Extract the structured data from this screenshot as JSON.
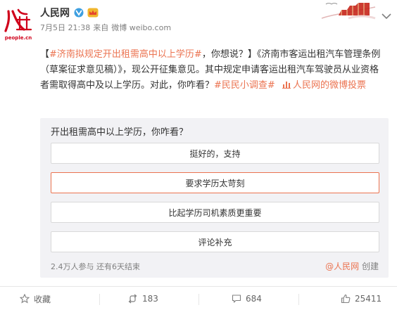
{
  "avatar": {
    "logo_text": "人民网",
    "domain_text": "people.cn",
    "icon": "people-daily-logo"
  },
  "post": {
    "author": "人民网",
    "verified_icon": "verified-v-icon",
    "member_icon": "vip-crown-icon",
    "date": "7月5日 21:38",
    "source_prefix": "来自",
    "source": "微博 weibo.com",
    "text": {
      "bracket_open": "【",
      "topic1": "#济南拟规定开出租需高中以上学历#",
      "line1_rest": "，你想说？】《济南市客运出租汽车管理条例（草案征求意见稿）》，现公开征集意见。其中规定申请客运出租汽车驾驶员从业资格者需取得高中及以上学历。对此，你咋看？",
      "topic2": "#民民小调查#",
      "vote_link": "人民网的微博投票"
    }
  },
  "poll": {
    "question": "开出租需高中以上学历，你咋看？",
    "options": [
      {
        "label": "挺好的，支持"
      },
      {
        "label": "要求学历太苛刻"
      },
      {
        "label": "比起学历司机素质更重要"
      },
      {
        "label": "评论补充"
      }
    ],
    "participants": "2.4万人参与",
    "remaining": "还有6天结束",
    "creator": "@人民网",
    "created_label": "创建"
  },
  "actions": {
    "favorite": "收藏",
    "repost": "183",
    "comment": "684",
    "like": "25411"
  },
  "colors": {
    "accent": "#eb7350",
    "link": "#eb7350",
    "muted": "#808080"
  }
}
